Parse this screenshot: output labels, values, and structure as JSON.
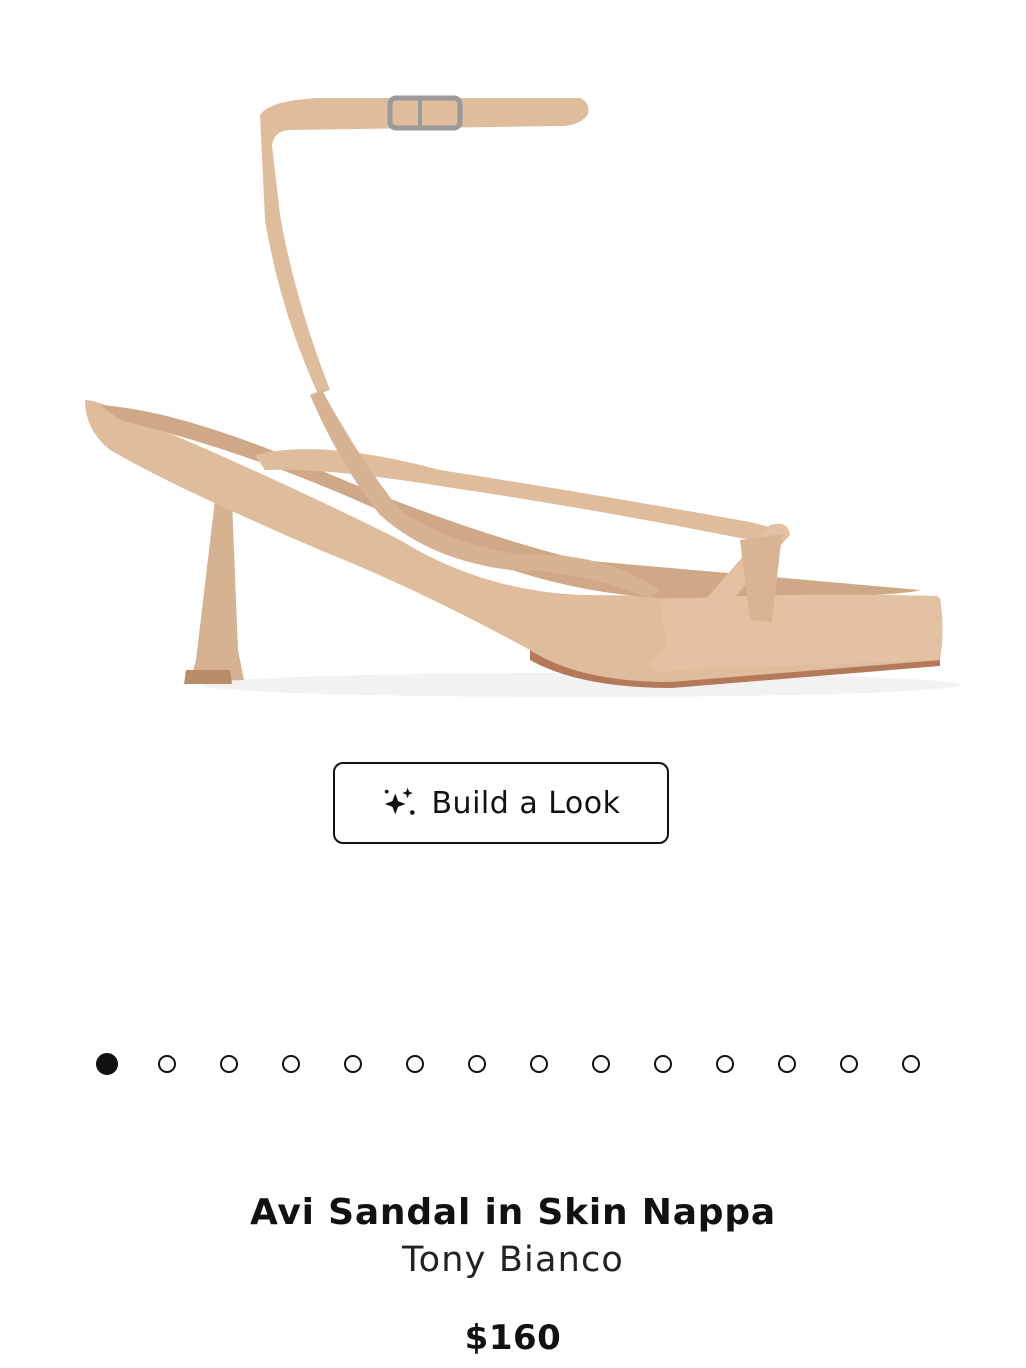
{
  "gallery": {
    "image_alt": "Avi Sandal in Skin Nappa",
    "total_slides": 14,
    "active_index": 0
  },
  "actions": {
    "build_look_label": "Build a Look",
    "build_look_icon": "sparkles-icon"
  },
  "product": {
    "title": "Avi Sandal in Skin Nappa",
    "brand": "Tony Bianco",
    "price": "$160"
  },
  "colors": {
    "sandal": "#dfbc9c",
    "sandal_shadow": "#c9a280",
    "sole": "#b5795a",
    "buckle": "#9a9a9a"
  }
}
